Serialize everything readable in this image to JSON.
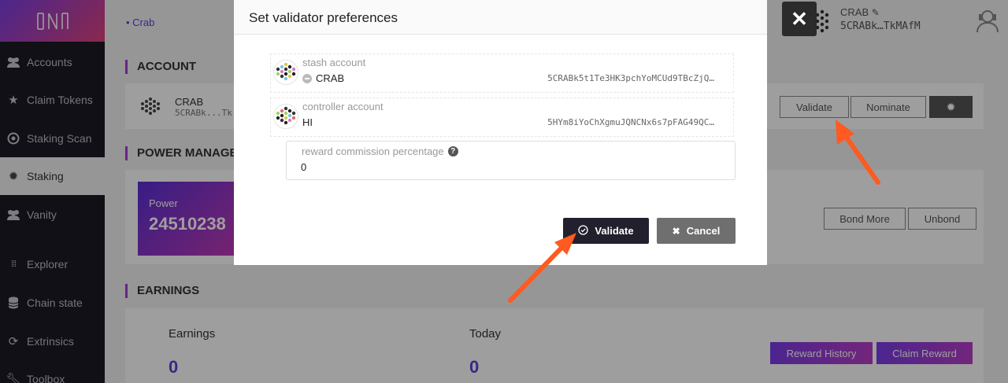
{
  "sidebar": {
    "logo": "ꞮꞮꞮ",
    "items": [
      {
        "label": "Accounts",
        "icon": "users-icon"
      },
      {
        "label": "Claim Tokens",
        "icon": "star-icon"
      },
      {
        "label": "Staking Scan",
        "icon": "target-icon"
      },
      {
        "label": "Staking",
        "icon": "gear-icon"
      },
      {
        "label": "Vanity",
        "icon": "users-icon"
      },
      {
        "label": "Explorer",
        "icon": "grid-icon"
      },
      {
        "label": "Chain state",
        "icon": "database-icon"
      },
      {
        "label": "Extrinsics",
        "icon": "refresh-icon"
      },
      {
        "label": "Toolbox",
        "icon": "wrench-icon"
      }
    ]
  },
  "breadcrumb": "• Crab",
  "sections": {
    "account": "ACCOUNT",
    "power": "POWER MANAGE",
    "earnings": "EARNINGS"
  },
  "account_card": {
    "name": "CRAB",
    "addr": "5CRABk...Tk",
    "buttons": {
      "validate": "Validate",
      "nominate": "Nominate"
    }
  },
  "power_card": {
    "label": "Power",
    "value": "24510238"
  },
  "bond_buttons": {
    "bond_more": "Bond More",
    "unbond": "Unbond"
  },
  "earnings": {
    "earnings_label": "Earnings",
    "earnings_value": "0",
    "today_label": "Today",
    "today_value": "0",
    "reward_history": "Reward History",
    "claim_reward": "Claim Reward"
  },
  "top_account": {
    "name": "CRAB",
    "addr": "5CRABk…TkMAfM"
  },
  "modal": {
    "title": "Set validator preferences",
    "close": "✕",
    "stash": {
      "label": "stash account",
      "name": "CRAB",
      "addr": "5CRABk5t1Te3HK3pchYoMCUd9TBcZjQ…"
    },
    "controller": {
      "label": "controller account",
      "name": "HI",
      "addr": "5HYm8iYoChXgmuJQNCNx6s7pFAG49QC…"
    },
    "commission": {
      "label": "reward commission percentage",
      "value": "0"
    },
    "validate_label": "Validate",
    "cancel_label": "Cancel"
  },
  "colors": {
    "accent": "#5c3fd8",
    "gradient_start": "#7a3ce6",
    "gradient_end": "#c039b4",
    "arrow": "#ff5a1f"
  }
}
